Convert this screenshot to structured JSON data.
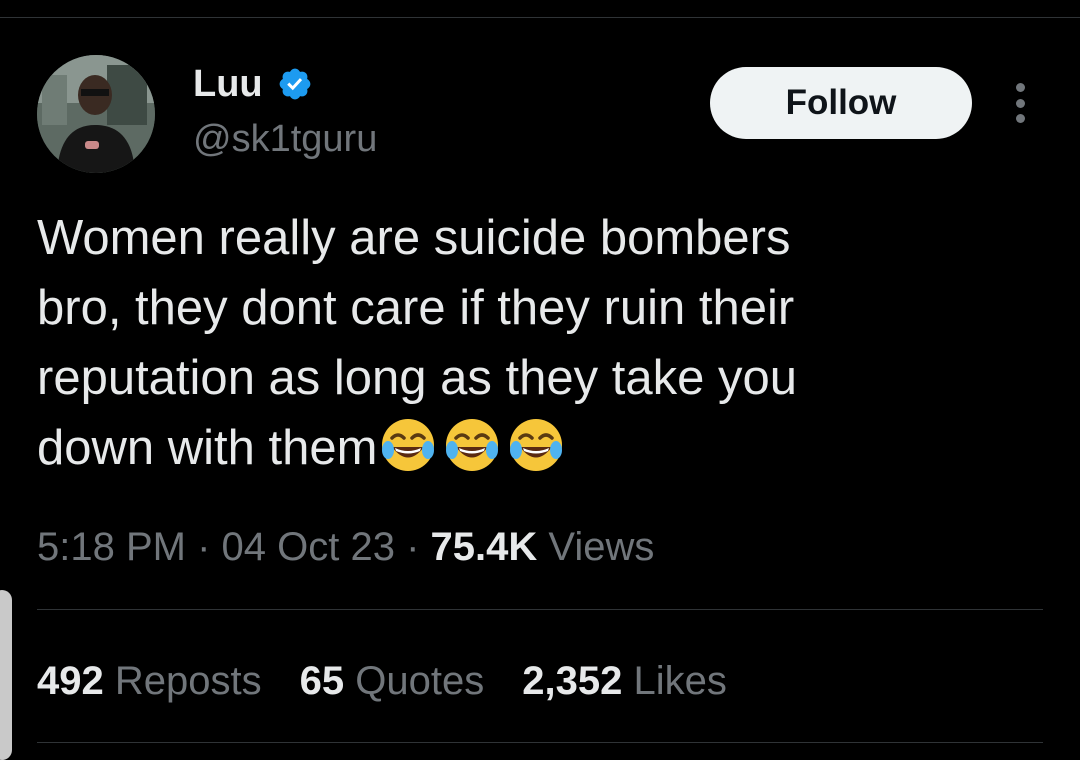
{
  "author": {
    "name": "Luu",
    "handle": "@sk1tguru",
    "verified": true
  },
  "follow_button": {
    "label": "Follow"
  },
  "tweet": {
    "lines": [
      "Women really are suicide bombers",
      "bro, they dont care if they ruin their",
      "reputation as long as they take you",
      "down with them"
    ],
    "emojis": [
      "face-with-tears-of-joy",
      "face-with-tears-of-joy",
      "face-with-tears-of-joy"
    ]
  },
  "meta": {
    "time": "5:18 PM",
    "separator": " · ",
    "date": "04 Oct 23",
    "views_count": "75.4K",
    "views_label": "Views"
  },
  "stats": {
    "reposts": {
      "count": "492",
      "label": "Reposts"
    },
    "quotes": {
      "count": "65",
      "label": "Quotes"
    },
    "likes": {
      "count": "2,352",
      "label": "Likes"
    }
  },
  "colors": {
    "background": "#000000",
    "primary_text": "#e7e9ea",
    "secondary_text": "#71767b",
    "verified_blue": "#1d9bf0",
    "divider": "#2f3336"
  }
}
